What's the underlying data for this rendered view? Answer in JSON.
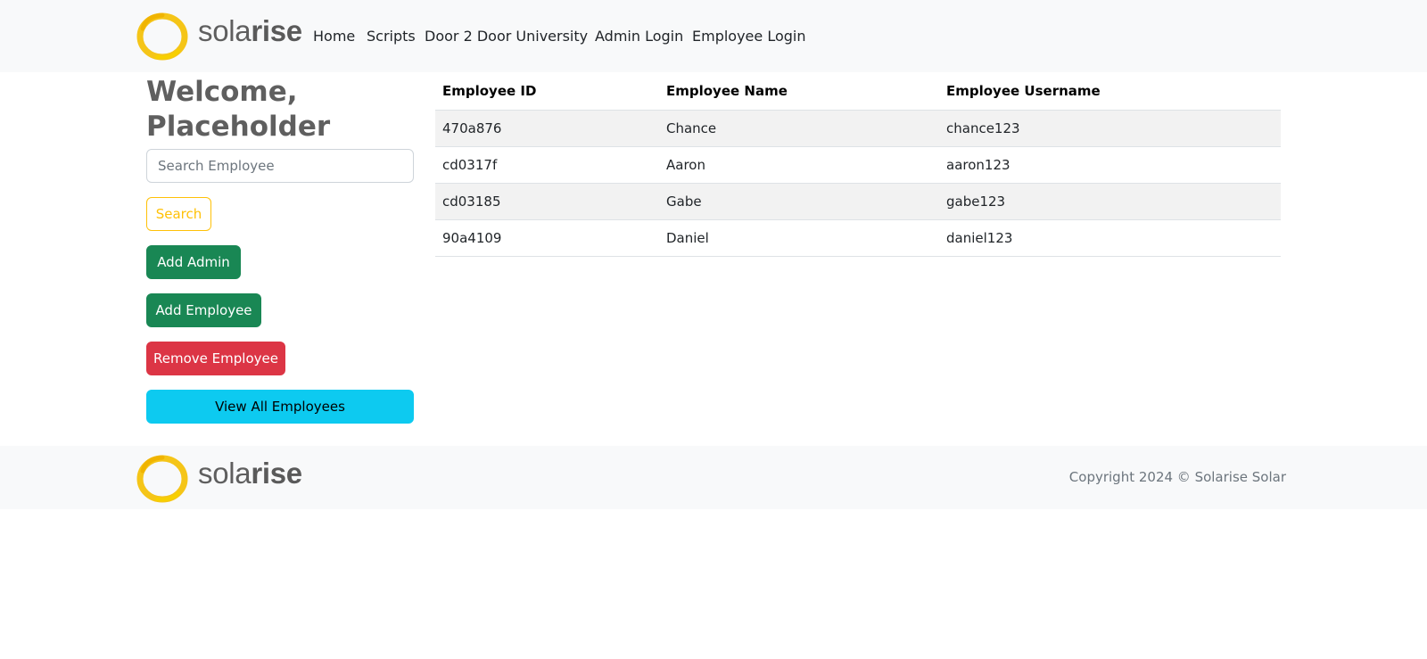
{
  "brand": {
    "logo_text_light": "sola",
    "logo_text_bold": "rise",
    "accent_color": "#f5c518"
  },
  "nav": {
    "items": [
      {
        "label": "Home"
      },
      {
        "label": "Scripts"
      },
      {
        "label": "Door 2 Door University"
      },
      {
        "label": "Admin Login"
      },
      {
        "label": "Employee Login"
      }
    ]
  },
  "sidebar": {
    "welcome": "Welcome, Placeholder",
    "search_placeholder": "Search Employee",
    "search_value": "",
    "search_label": "Search",
    "add_admin_label": "Add Admin",
    "add_employee_label": "Add Employee",
    "remove_employee_label": "Remove Employee",
    "view_all_label": "View All Employees"
  },
  "table": {
    "headers": [
      "Employee ID",
      "Employee Name",
      "Employee Username"
    ],
    "rows": [
      [
        "470a876",
        "Chance",
        "chance123"
      ],
      [
        "cd0317f",
        "Aaron",
        "aaron123"
      ],
      [
        "cd03185",
        "Gabe",
        "gabe123"
      ],
      [
        "90a4109",
        "Daniel",
        "daniel123"
      ]
    ]
  },
  "footer": {
    "copyright": "Copyright 2024 © Solarise Solar"
  },
  "colors": {
    "success": "#198754",
    "danger": "#dc3545",
    "info": "#0dcaf0",
    "warning": "#ffc107"
  }
}
